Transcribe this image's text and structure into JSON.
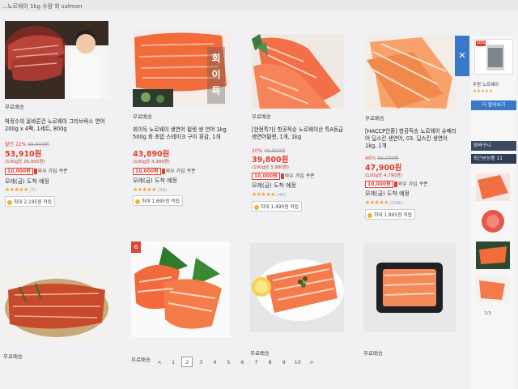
{
  "topbar": {
    "text": "…노르웨이 1kg  수량  회  salmon"
  },
  "products_row1": [
    {
      "free_shipping": "무료배송",
      "title": "박정수의 올바른건 노르웨이 그라브락스 연어 200g x 4팩, 1세트, 800g",
      "discount_pct": "할인 22%",
      "original_price": "69,900원",
      "price": "53,910원",
      "unit_price": "(100g당 26,955원)",
      "coupon_amount": "10,000원",
      "coupon_text": "와우 가입 쿠폰",
      "delivery": "모레(금) 도착 예정",
      "stars": "★★★★★",
      "review_count": "(7)",
      "points": "최대 2,195원 적립"
    },
    {
      "free_shipping": "무료배송",
      "title": "회이득 노르웨이 생연어 필렛 생 연어 1kg 500g 회 초밥 스테이크 구이 횟감, 1개",
      "discount_pct": "",
      "original_price": "",
      "price": "43,890원",
      "unit_price": "(100g당 4,389원)",
      "coupon_amount": "10,000원",
      "coupon_text": "와우 가입 쿠폰",
      "delivery": "모레(금) 도착 예정",
      "stars": "★★★★★",
      "review_count": "(26)",
      "points": "최대 1,695원 적립",
      "image_text": "회이득"
    },
    {
      "free_shipping": "무료배송",
      "title": "[한정특가] 항공직송 노르웨이산 특A등급 생연어필렛, 1개, 1kg",
      "discount_pct": "20%",
      "original_price": "49,800원",
      "price": "39,800원",
      "unit_price": "(100g당 3,980원)",
      "coupon_amount": "10,000원",
      "coupon_text": "와우 가입 쿠폰",
      "delivery": "모레(금) 도착 예정",
      "stars": "★★★★★",
      "review_count": "(40)",
      "points": "최대 1,490원 적립"
    },
    {
      "free_shipping": "무료배송",
      "title": "[HACCP인증] 항공직송 노르웨이 슈페리어 딥스킨 생연어, 03. 딥스킨 생연어 1kg, 1개",
      "discount_pct": "46%",
      "original_price": "89,000원",
      "price": "47,900원",
      "unit_price": "(100g당 4,790원)",
      "coupon_amount": "10,000원",
      "coupon_text": "와우 가입 쿠폰",
      "delivery": "모레(금) 도착 예정",
      "stars": "★★★★★",
      "review_count": "(336)",
      "points": "최대 1,895원 적립"
    }
  ],
  "products_row2": [
    {
      "free_shipping": "무료배송"
    },
    {
      "free_shipping": "무료배송",
      "rank_badge": "6"
    },
    {
      "free_shipping": "무료배송"
    },
    {
      "free_shipping": "무료배송"
    }
  ],
  "pagination": {
    "prev": "<",
    "pages": [
      "1",
      "2",
      "3",
      "4",
      "5",
      "6",
      "7",
      "8",
      "9",
      "10"
    ],
    "current": "2",
    "next": ">"
  },
  "sidebar": {
    "close": "✕",
    "discount_tag": "10%",
    "product_name": "두원 노르웨이",
    "stars": "★★★★★",
    "more_button": "더 알아보기",
    "cart": "장바구니",
    "recent_label": "최근본상품",
    "recent_count": "11",
    "pager": "1/3"
  },
  "colors": {
    "price_red": "#e1402e",
    "accent_blue": "#3a78c9",
    "star_orange": "#f1a32a"
  }
}
